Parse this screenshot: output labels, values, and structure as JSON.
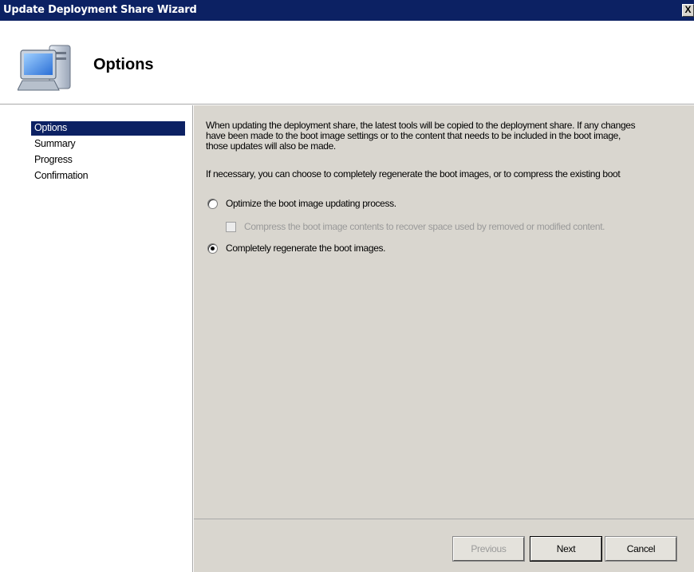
{
  "window": {
    "title": "Update Deployment Share Wizard",
    "close_glyph": "X"
  },
  "header": {
    "heading": "Options",
    "icon": "computer-monitor-icon"
  },
  "sidebar": {
    "items": [
      {
        "label": "Options",
        "selected": true
      },
      {
        "label": "Summary",
        "selected": false
      },
      {
        "label": "Progress",
        "selected": false
      },
      {
        "label": "Confirmation",
        "selected": false
      }
    ]
  },
  "content": {
    "description_lines": [
      "When updating the deployment share, the latest tools will be copied to the deployment share.  If any changes",
      "have been made to the boot image settings or to the content that needs to be included in the boot image,",
      "those updates will also be made."
    ],
    "instruction": "If necessary, you can choose to completely regenerate the boot images, or to compress the existing boot",
    "options": {
      "optimize": {
        "label": "Optimize the boot image updating process.",
        "checked": false
      },
      "compress": {
        "label": "Compress the boot image contents to recover space used by removed or modified content.",
        "checked": false,
        "enabled": false
      },
      "regenerate": {
        "label": "Completely regenerate the boot images.",
        "checked": true
      }
    }
  },
  "footer": {
    "previous_label": "Previous",
    "next_label": "Next",
    "cancel_label": "Cancel"
  },
  "colors": {
    "titlebar": "#0c2163",
    "panel": "#d9d6cf",
    "selection": "#0c2163"
  }
}
